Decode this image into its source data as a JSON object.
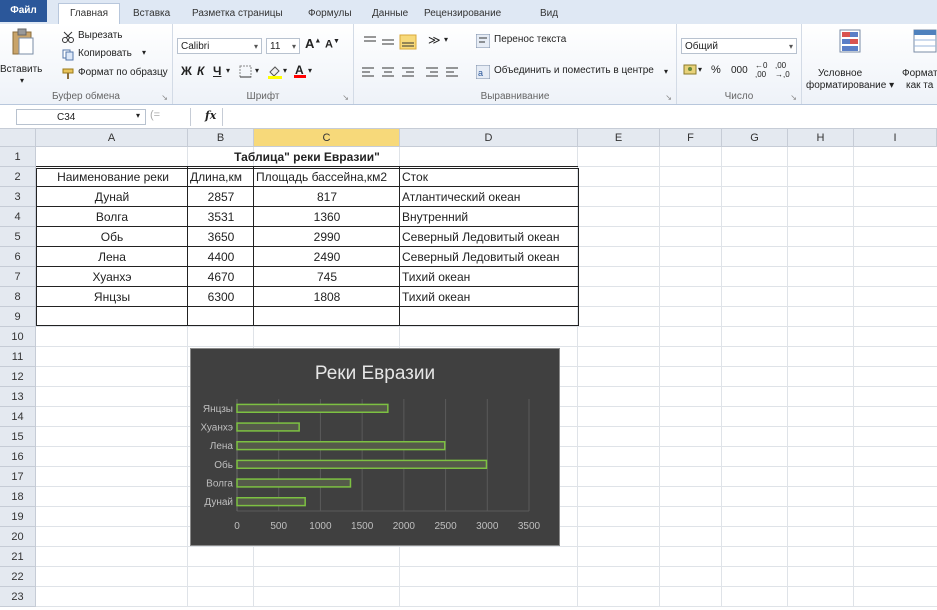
{
  "tabs": {
    "file": "Файл",
    "home": "Главная",
    "insert": "Вставка",
    "page_layout": "Разметка страницы",
    "formulas": "Формулы",
    "data": "Данные",
    "review": "Рецензирование",
    "view": "Вид"
  },
  "ribbon": {
    "clipboard": {
      "paste": "Вставить",
      "cut": "Вырезать",
      "copy": "Копировать",
      "format_painter": "Формат по образцу",
      "label": "Буфер обмена"
    },
    "font": {
      "name": "Calibri",
      "size": "11",
      "bold": "Ж",
      "italic": "К",
      "underline": "Ч",
      "label": "Шрифт"
    },
    "alignment": {
      "wrap_text": "Перенос текста",
      "merge_center": "Объединить и поместить в центре",
      "label": "Выравнивание"
    },
    "number": {
      "format": "Общий",
      "percent": "%",
      "thousands": "000",
      "label": "Число"
    },
    "styles": {
      "conditional": "Условное",
      "conditional2": "форматирование",
      "format_as_table": "Формат",
      "format_as_table2": "как та"
    }
  },
  "formula_bar": {
    "name_box": "C34",
    "fx": "fx",
    "content": ""
  },
  "columns": [
    "A",
    "B",
    "C",
    "D",
    "E",
    "F",
    "G",
    "H",
    "I"
  ],
  "rows": [
    "1",
    "2",
    "3",
    "4",
    "5",
    "6",
    "7",
    "8",
    "9",
    "10",
    "11",
    "12",
    "13",
    "14",
    "15",
    "16",
    "17",
    "18",
    "19",
    "20",
    "21",
    "22",
    "23"
  ],
  "sheet": {
    "title": "Таблица\" реки Евразии\"",
    "headers": [
      "Наименование реки",
      "Длина,км",
      "Площадь бассейна,км2",
      "Сток"
    ],
    "data": [
      [
        "Дунай",
        "2857",
        "817",
        "Атлантический океан"
      ],
      [
        "Волга",
        "3531",
        "1360",
        "Внутренний"
      ],
      [
        "Обь",
        "3650",
        "2990",
        "Северный Ледовитый океан"
      ],
      [
        "Лена",
        "4400",
        "2490",
        "Северный Ледовитый океан"
      ],
      [
        "Хуанхэ",
        "4670",
        "745",
        "Тихий океан"
      ],
      [
        "Янцзы",
        "6300",
        "1808",
        "Тихий океан"
      ]
    ]
  },
  "colors": {
    "file_tab": "#2b579a",
    "chart_bg": "#404040",
    "bar_stroke": "#7dc142",
    "selected_header": "#f7d97a"
  },
  "chart_data": {
    "type": "bar",
    "orientation": "horizontal",
    "title": "Реки Евразии",
    "categories": [
      "Дунай",
      "Волга",
      "Обь",
      "Лена",
      "Хуанхэ",
      "Янцзы"
    ],
    "values": [
      817,
      1360,
      2990,
      2490,
      745,
      1808
    ],
    "xlim": [
      0,
      3500
    ],
    "xticks": [
      0,
      500,
      1000,
      1500,
      2000,
      2500,
      3000,
      3500
    ],
    "grid": true,
    "legend": "none"
  }
}
